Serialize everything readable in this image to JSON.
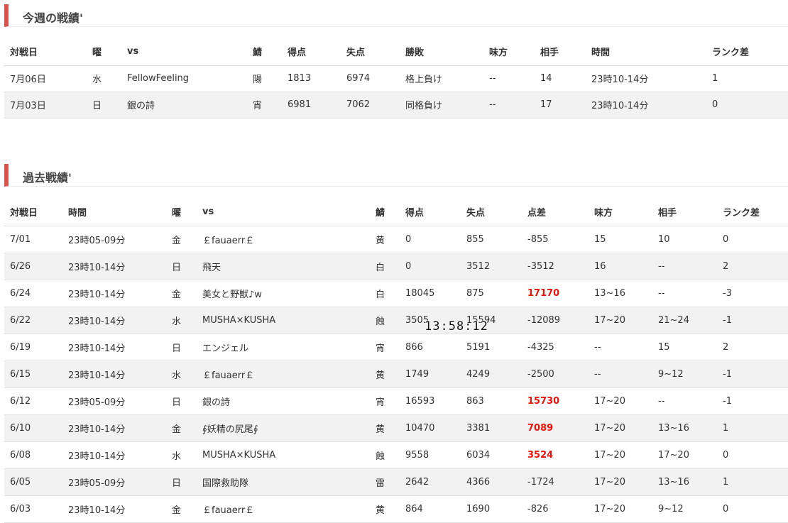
{
  "weekly": {
    "title": "今週の戦績'",
    "headers": [
      "対戦日",
      "曜",
      "vs",
      "鯖",
      "得点",
      "失点",
      "勝敗",
      "味方",
      "相手",
      "時間",
      "ランク差"
    ],
    "rows": [
      [
        "7月06日",
        "水",
        "FellowFeeling",
        "陽",
        "1813",
        "6974",
        "格上負け",
        "--",
        "14",
        "23時10-14分",
        "1"
      ],
      [
        "7月03日",
        "日",
        "銀の詩",
        "宵",
        "6981",
        "7062",
        "同格負け",
        "--",
        "17",
        "23時10-14分",
        "0"
      ]
    ]
  },
  "past": {
    "title": "過去戦績'",
    "headers": [
      "対戦日",
      "時間",
      "曜",
      "vs",
      "鯖",
      "得点",
      "失点",
      "点差",
      "味方",
      "相手",
      "ランク差"
    ],
    "rows": [
      [
        "7/01",
        "23時05-09分",
        "金",
        "￡fauaerr￡",
        "黄",
        "0",
        "855",
        "-855",
        "15",
        "10",
        "0"
      ],
      [
        "6/26",
        "23時10-14分",
        "日",
        "飛天",
        "白",
        "0",
        "3512",
        "-3512",
        "16",
        "--",
        "2"
      ],
      [
        "6/24",
        "23時10-14分",
        "金",
        "美女と野獣♪w",
        "白",
        "18045",
        "875",
        "17170",
        "13~16",
        "--",
        "-3"
      ],
      [
        "6/22",
        "23時10-14分",
        "水",
        "MUSHA×KUSHA",
        "蝕",
        "3505",
        "15594",
        "-12089",
        "17~20",
        "21~24",
        "-1"
      ],
      [
        "6/19",
        "23時10-14分",
        "日",
        "エンジェル",
        "宵",
        "866",
        "5191",
        "-4325",
        "--",
        "15",
        "2"
      ],
      [
        "6/15",
        "23時10-14分",
        "水",
        "￡fauaerr￡",
        "黄",
        "1749",
        "4249",
        "-2500",
        "--",
        "9~12",
        "-1"
      ],
      [
        "6/12",
        "23時05-09分",
        "日",
        "銀の詩",
        "宵",
        "16593",
        "863",
        "15730",
        "17~20",
        "--",
        "-1"
      ],
      [
        "6/10",
        "23時10-14分",
        "金",
        "∮妖精の尻尾∮",
        "黄",
        "10470",
        "3381",
        "7089",
        "17~20",
        "13~16",
        "1"
      ],
      [
        "6/08",
        "23時10-14分",
        "水",
        "MUSHA×KUSHA",
        "蝕",
        "9558",
        "6034",
        "3524",
        "17~20",
        "17~20",
        "0"
      ],
      [
        "6/05",
        "23時05-09分",
        "日",
        "国際救助隊",
        "雷",
        "2642",
        "4366",
        "-1724",
        "17~20",
        "13~16",
        "1"
      ],
      [
        "6/03",
        "23時10-14分",
        "金",
        "￡fauaerr￡",
        "黄",
        "864",
        "1690",
        "-826",
        "17~20",
        "9~12",
        "0"
      ]
    ]
  },
  "overlay_clock": "13:58:12",
  "colors": {
    "accent_bar": "#d9534f",
    "highlight_positive": "#e8130b",
    "row_alt": "#f2f2f2"
  }
}
